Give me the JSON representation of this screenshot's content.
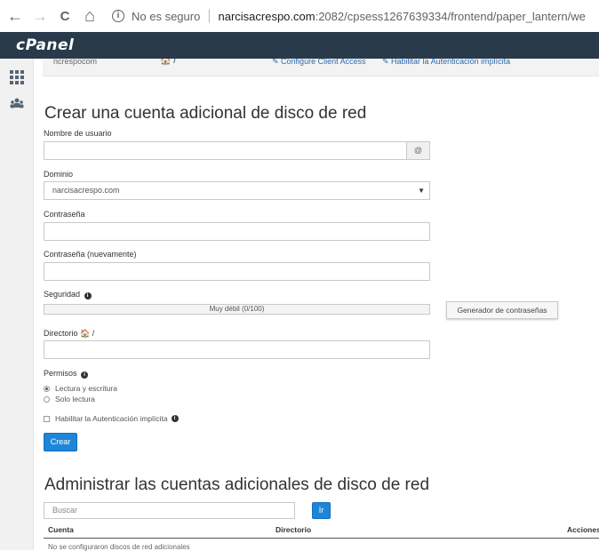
{
  "browser": {
    "back_glyph": "←",
    "forward_glyph": "→",
    "reload_glyph": "C",
    "home_glyph": "⌂",
    "security_label": "No es seguro",
    "url_host": "narcisacrespo.com",
    "url_rest": ":2082/cpsess1267639334/frontend/paper_lantern/we"
  },
  "header": {
    "logo": "cPanel",
    "bg_color": "#293a4a"
  },
  "top_strip": {
    "user": "ncrespocom",
    "home": "🏠 /",
    "link1": "Configure Client Access",
    "link2": "Habilitar la Autenticación implícita"
  },
  "form": {
    "title": "Crear una cuenta adicional de disco de red",
    "username_label": "Nombre de usuario",
    "username_value": "",
    "at_addon": "@",
    "domain_label": "Dominio",
    "domain_selected": "narcisacrespo.com",
    "password_label": "Contraseña",
    "password_again_label": "Contraseña (nuevamente)",
    "security_label": "Seguridad",
    "strength_text": "Muy débil (0/100)",
    "generator_button": "Generador de contraseñas",
    "directory_label": "Directorio",
    "directory_suffix": "🏠 /",
    "permissions_label": "Permisos",
    "perm_rw": "Lectura y escritura",
    "perm_ro": "Solo lectura",
    "digest_auth": "Habilitar la Autenticación implícita",
    "create_button": "Crear",
    "accent_color": "#1e86d9"
  },
  "manage": {
    "title": "Administrar las cuentas adicionales de disco de red",
    "search_placeholder": "Buscar",
    "go_button": "Ir",
    "columns": [
      "Cuenta",
      "Directorio",
      "Acciones"
    ],
    "empty_message": "No se configuraron discos de red adicionales"
  }
}
